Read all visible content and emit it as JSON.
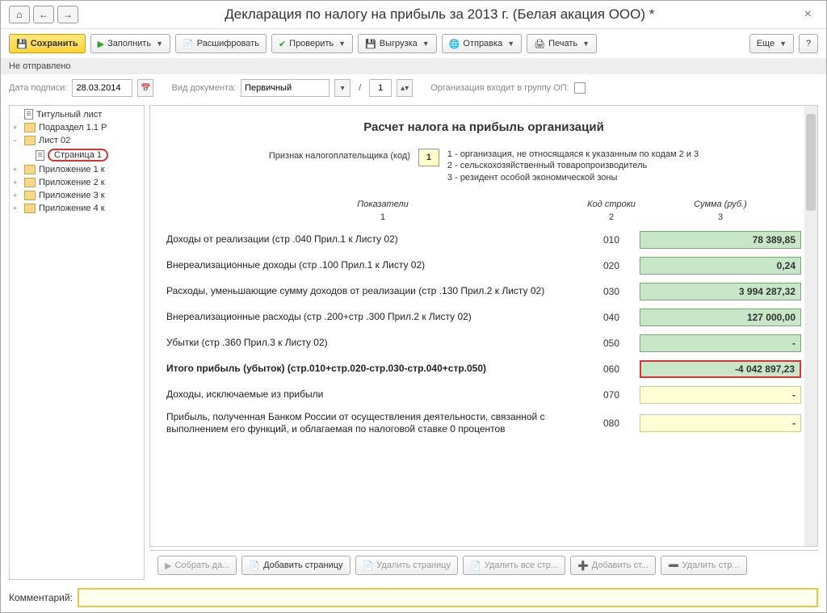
{
  "window": {
    "title": "Декларация по налогу на прибыль за 2013 г. (Белая акация ООО) *"
  },
  "toolbar": {
    "save": "Сохранить",
    "fill": "Заполнить",
    "decode": "Расшифровать",
    "check": "Проверить",
    "export": "Выгрузка",
    "send": "Отправка",
    "print": "Печать",
    "more": "Еще"
  },
  "status": "Не отправлено",
  "params": {
    "sign_date_label": "Дата подписи:",
    "sign_date": "28.03.2014",
    "doc_type_label": "Вид документа:",
    "doc_type": "Первичный",
    "slash": "/",
    "corr_num": "1",
    "org_group_label": "Организация входит в группу ОП:"
  },
  "tree": {
    "items": [
      {
        "level": 0,
        "icon": "doc",
        "label": "Титульный лист",
        "exp": ""
      },
      {
        "level": 0,
        "icon": "folder",
        "label": "Подраздел 1.1 Р",
        "exp": "+"
      },
      {
        "level": 0,
        "icon": "folder",
        "label": "Лист 02",
        "exp": "−"
      },
      {
        "level": 1,
        "icon": "doc",
        "label": "Страница 1",
        "exp": "",
        "selected": true
      },
      {
        "level": 0,
        "icon": "folder",
        "label": "Приложение 1 к",
        "exp": "+"
      },
      {
        "level": 0,
        "icon": "folder",
        "label": "Приложение 2 к",
        "exp": "+"
      },
      {
        "level": 0,
        "icon": "folder",
        "label": "Приложение 3 к",
        "exp": "+"
      },
      {
        "level": 0,
        "icon": "folder",
        "label": "Приложение 4 к",
        "exp": "+"
      }
    ]
  },
  "form": {
    "section_title": "Расчет налога на прибыль организаций",
    "taxpayer_label": "Признак налогоплательщика (код)",
    "taxpayer_code": "1",
    "taxpayer_legend1": "1 - организация, не относящаяся к указанным по кодам 2 и 3",
    "taxpayer_legend2": "2 - сельскохозяйственный товаропроизводитель",
    "taxpayer_legend3": "3 - резидент особой экономической зоны",
    "col1_h": "Показатели",
    "col2_h": "Код строки",
    "col3_h": "Сумма (руб.)",
    "col1_n": "1",
    "col2_n": "2",
    "col3_n": "3",
    "rows": [
      {
        "label": "Доходы от реализации (стр .040 Прил.1 к Листу 02)",
        "code": "010",
        "sum": "78 389,85",
        "style": "green"
      },
      {
        "label": "Внереализационные доходы (стр .100 Прил.1 к Листу 02)",
        "code": "020",
        "sum": "0,24",
        "style": "green"
      },
      {
        "label": "Расходы, уменьшающие сумму доходов от реализации (стр .130 Прил.2 к Листу 02)",
        "code": "030",
        "sum": "3 994 287,32",
        "style": "green"
      },
      {
        "label": "Внереализационные расходы (стр .200+стр .300 Прил.2 к Листу 02)",
        "code": "040",
        "sum": "127 000,00",
        "style": "green"
      },
      {
        "label": "Убытки (стр .360 Прил.3 к Листу 02)",
        "code": "050",
        "sum": "-",
        "style": "green"
      },
      {
        "label": "Итого прибыль (убыток)        (стр.010+стр.020-стр.030-стр.040+стр.050)",
        "code": "060",
        "sum": "-4 042 897,23",
        "style": "red",
        "bold": true
      },
      {
        "label": "Доходы, исключаемые из прибыли",
        "code": "070",
        "sum": "-",
        "style": "yellow"
      },
      {
        "label": "Прибыль, полученная Банком России от осуществления деятельности, связанной с выполнением его функций, и облагаемая по налоговой ставке 0 процентов",
        "code": "080",
        "sum": "-",
        "style": "yellow"
      }
    ]
  },
  "bottom_toolbar": {
    "collect": "Собрать да...",
    "add_page": "Добавить страницу",
    "del_page": "Удалить страницу",
    "del_all": "Удалить все стр...",
    "add_str": "Добавить ст...",
    "del_str": "Удалить стр..."
  },
  "comment_label": "Комментарий:"
}
